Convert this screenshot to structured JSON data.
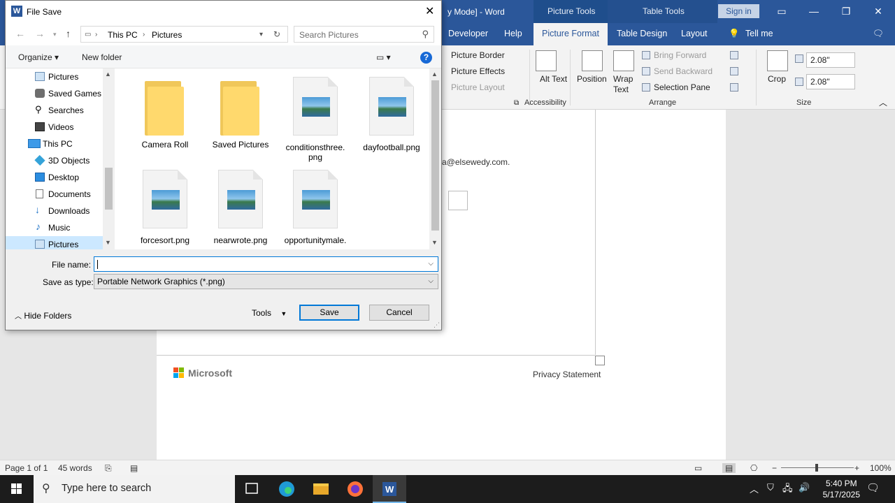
{
  "word": {
    "title": "y Mode]  -  Word",
    "context_groups": [
      "Picture Tools",
      "Table Tools"
    ],
    "sign_in": "Sign in",
    "tabs": [
      "Developer",
      "Help",
      "Picture Format",
      "Table Design",
      "Layout"
    ],
    "active_tab": "Picture Format",
    "tell_me": "Tell me",
    "ribbon": {
      "picture_border": "Picture Border",
      "picture_effects": "Picture Effects",
      "picture_layout": "Picture Layout",
      "alt_text": "Alt Text",
      "accessibility_group": "Accessibility",
      "position": "Position",
      "wrap_text": "Wrap Text",
      "bring_forward": "Bring Forward",
      "send_backward": "Send Backward",
      "selection_pane": "Selection Pane",
      "arrange_group": "Arrange",
      "crop": "Crop",
      "height": "2.08\"",
      "width": "2.08\"",
      "size_group": "Size"
    },
    "document": {
      "email_fragment": "a@elsewedy.com.",
      "footer_brand": "Microsoft",
      "privacy": "Privacy Statement"
    },
    "status": {
      "page": "Page 1 of 1",
      "words": "45 words",
      "zoom": "100%"
    }
  },
  "dialog": {
    "title": "File Save",
    "breadcrumb": [
      "This PC",
      "Pictures"
    ],
    "search_placeholder": "Search Pictures",
    "organize": "Organize",
    "new_folder": "New folder",
    "help": "?",
    "nav_items": [
      {
        "label": "Pictures",
        "icon": "pictures-icon"
      },
      {
        "label": "Saved Games",
        "icon": "saved-games-icon"
      },
      {
        "label": "Searches",
        "icon": "search-icon"
      },
      {
        "label": "Videos",
        "icon": "videos-icon"
      },
      {
        "label": "This PC",
        "icon": "computer-icon"
      },
      {
        "label": "3D Objects",
        "icon": "3d-objects-icon"
      },
      {
        "label": "Desktop",
        "icon": "desktop-icon"
      },
      {
        "label": "Documents",
        "icon": "documents-icon"
      },
      {
        "label": "Downloads",
        "icon": "downloads-icon"
      },
      {
        "label": "Music",
        "icon": "music-icon"
      },
      {
        "label": "Pictures",
        "icon": "pictures-icon"
      }
    ],
    "files": [
      {
        "name": "Camera Roll",
        "kind": "folder"
      },
      {
        "name": "Saved Pictures",
        "kind": "folder"
      },
      {
        "name": "conditionsthree.\npng",
        "kind": "image"
      },
      {
        "name": "dayfootball.png",
        "kind": "image"
      },
      {
        "name": "forcesort.png",
        "kind": "image"
      },
      {
        "name": "nearwrote.png",
        "kind": "image"
      },
      {
        "name": "opportunitymale.",
        "kind": "image"
      }
    ],
    "file_name_label": "File name:",
    "file_name_value": "",
    "save_as_type_label": "Save as type:",
    "save_as_type_value": "Portable Network Graphics (*.png)",
    "hide_folders": "Hide Folders",
    "tools": "Tools",
    "save": "Save",
    "cancel": "Cancel"
  },
  "taskbar": {
    "search_placeholder": "Type here to search",
    "time": "5:40 PM",
    "date": "5/17/2025"
  }
}
